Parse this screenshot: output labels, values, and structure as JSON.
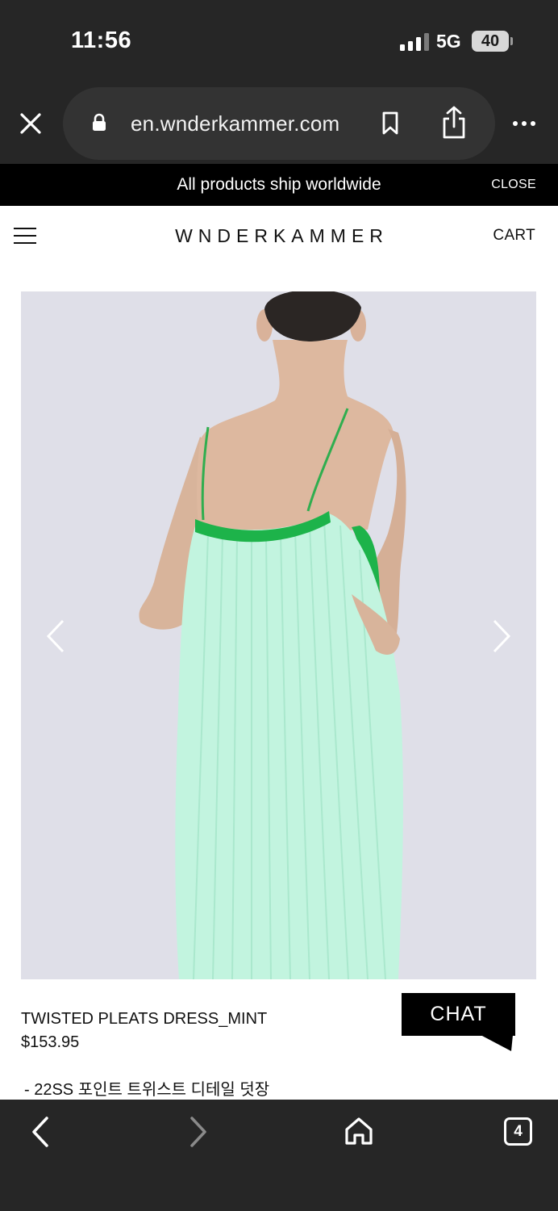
{
  "status_bar": {
    "time": "11:56",
    "network": "5G",
    "battery": "40"
  },
  "browser": {
    "url": "en.wnderkammer.com",
    "icons": [
      "close-icon",
      "lock-icon",
      "bookmark-icon",
      "share-icon",
      "more-icon"
    ]
  },
  "banner": {
    "text": "All products ship worldwide",
    "close_label": "CLOSE"
  },
  "header": {
    "logo": "WNDERKAMMER",
    "cart_label": "CART",
    "icons": [
      "hamburger-menu-icon"
    ]
  },
  "product": {
    "image_icons": [
      "chevron-left-icon",
      "chevron-right-icon"
    ],
    "name": "TWISTED PLEATS DRESS_MINT",
    "price": "$153.95",
    "description": " - 22SS 포인트 트위스트 디테일 덧장"
  },
  "chat": {
    "label": "CHAT"
  },
  "bottom_toolbar": {
    "tab_count": "4",
    "icons": [
      "back-icon",
      "forward-icon",
      "home-icon",
      "tabs-icon"
    ]
  },
  "colors": {
    "chrome_bg": "#262626",
    "banner_bg": "#000000",
    "image_bg": "#dfdfe8",
    "dress_mint": "#bff3de",
    "dress_green_trim": "#1db34a",
    "forward_disabled": "#8a8a8a"
  }
}
